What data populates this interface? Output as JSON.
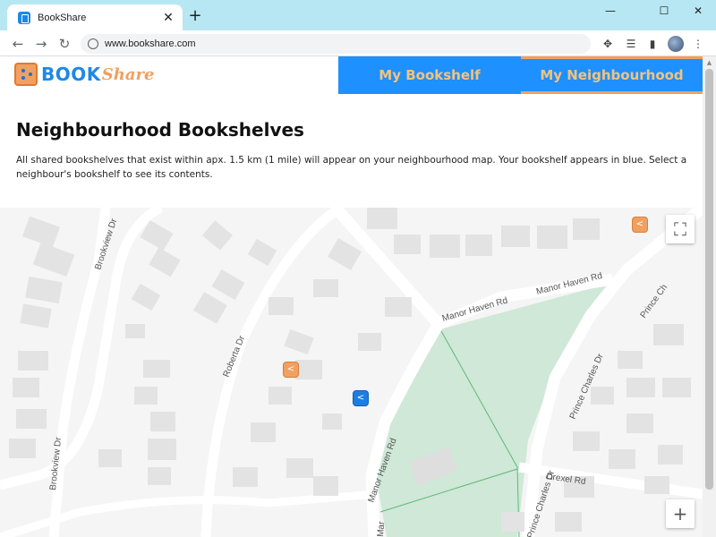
{
  "browser": {
    "tab_title": "BookShare",
    "tab_close": "✕",
    "new_tab": "+",
    "url": "www.bookshare.com",
    "window_controls": {
      "minimize": "—",
      "maximize": "☐",
      "close": "✕"
    },
    "nav": {
      "back": "←",
      "forward": "→",
      "reload": "↻"
    },
    "toolbar_icons": {
      "extensions": "✥",
      "reading_list": "☰",
      "side_panel": "▮",
      "menu": "⋮"
    }
  },
  "site": {
    "logo_book": "BOOK",
    "logo_share": "Share",
    "nav_tabs": [
      {
        "label": "My Bookshelf",
        "active": false
      },
      {
        "label": "My Neighbourhood",
        "active": true
      }
    ],
    "heading": "Neighbourhood Bookshelves",
    "description": "All shared bookshelves that exist within apx. 1.5 km (1 mile) will appear on your neighbourhood map. Your bookshelf appears in blue. Select a neighbour's bookshelf to see its contents.",
    "colors": {
      "accent_blue": "#1e90ff",
      "accent_orange": "#f0a060",
      "park_green": "#cfe8d7"
    }
  },
  "map": {
    "roads": {
      "brookview_dr_1": "Brookview Dr",
      "brookview_dr_2": "Brookview Dr",
      "roberta_dr": "Roberta Dr",
      "manor_haven_rd_1": "Manor Haven Rd",
      "manor_haven_rd_2": "Manor Haven Rd",
      "manor_haven_rd_3": "Manor Haven Rd",
      "prince_charles_dr_1": "Prince Charles Dr",
      "prince_charles_dr_2": "Prince Charles Dr",
      "prince_charles_dr_3": "Prince Ch",
      "drexel_rd": "Drexel Rd",
      "manor_partial": "Mar"
    },
    "controls": {
      "fullscreen": "⛶",
      "zoom_in": "+"
    },
    "markers": [
      {
        "name": "neighbour-bookshelf",
        "color": "orange"
      },
      {
        "name": "my-bookshelf",
        "color": "blue"
      },
      {
        "name": "neighbour-bookshelf",
        "color": "orange"
      }
    ],
    "marker_glyph": "<"
  }
}
